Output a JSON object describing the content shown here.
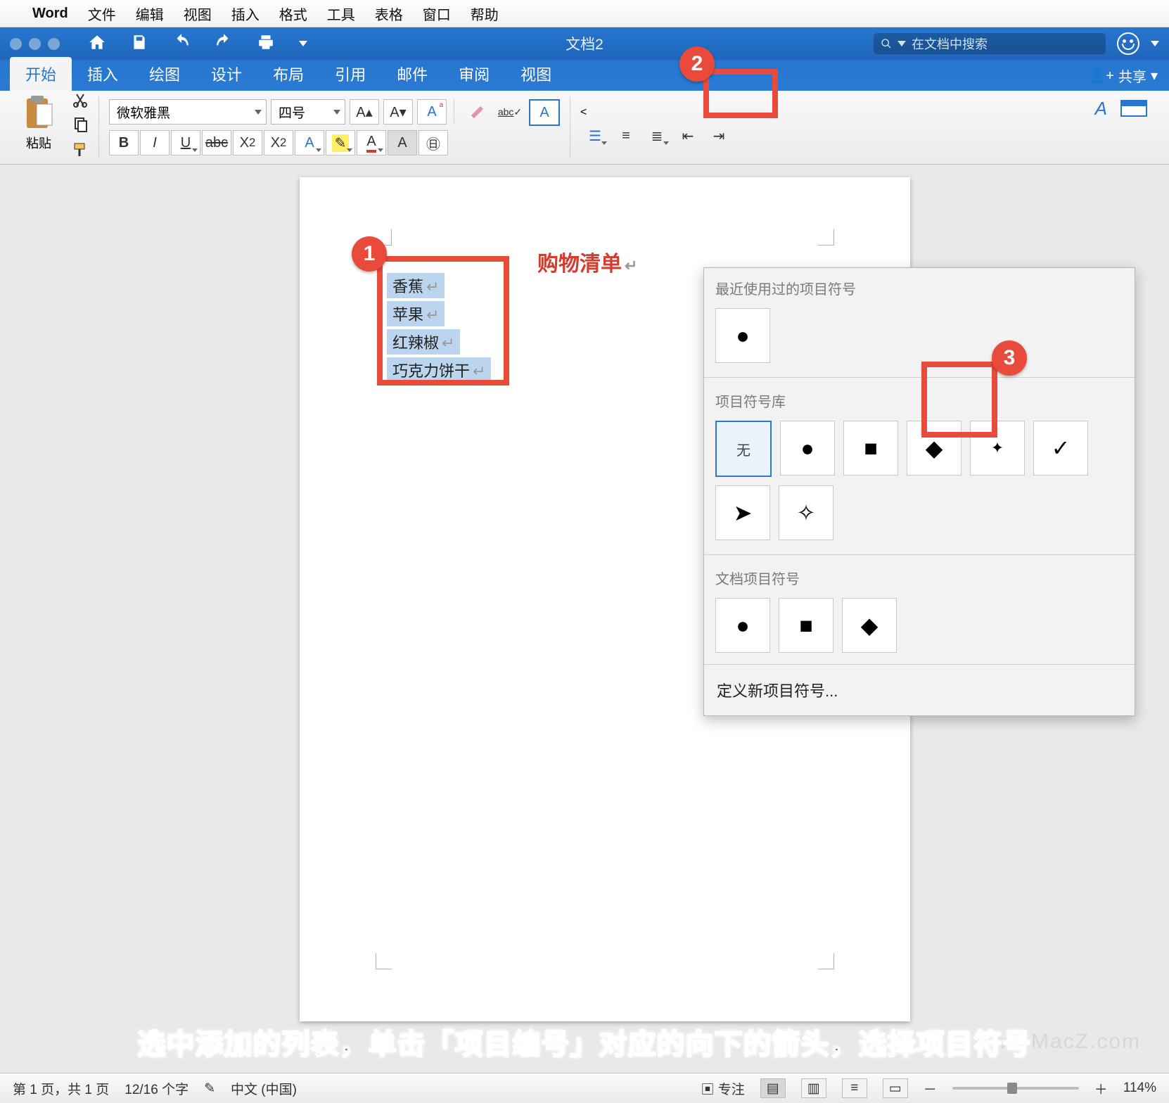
{
  "mac_menu": {
    "app": "Word",
    "items": [
      "文件",
      "编辑",
      "视图",
      "插入",
      "格式",
      "工具",
      "表格",
      "窗口",
      "帮助"
    ]
  },
  "titlebar": {
    "doc": "文档2",
    "search_placeholder": "在文档中搜索"
  },
  "ribbon_tabs": [
    "开始",
    "插入",
    "绘图",
    "设计",
    "布局",
    "引用",
    "邮件",
    "审阅",
    "视图"
  ],
  "ribbon_active_tab": "开始",
  "share_label": "共享",
  "paste_label": "粘贴",
  "font": {
    "name": "微软雅黑",
    "size": "四号"
  },
  "document": {
    "heading": "购物清单",
    "list": [
      "香蕉",
      "苹果",
      "红辣椒",
      "巧克力饼干"
    ]
  },
  "bullet_panel": {
    "recent_label": "最近使用过的项目符号",
    "recent": [
      "disc"
    ],
    "library_label": "项目符号库",
    "library": [
      "无",
      "disc",
      "square",
      "diamond",
      "image",
      "check",
      "arrow",
      "star4"
    ],
    "document_label": "文档项目符号",
    "doc_bullets": [
      "disc",
      "square",
      "diamond"
    ],
    "define_new": "定义新项目符号...",
    "selected_library_index": 0,
    "highlight_index": 3
  },
  "annotations": {
    "step1": "1",
    "step2": "2",
    "step3": "3"
  },
  "caption": "选中添加的列表，单击「项目编号」对应的向下的箭头，选择项目符号",
  "watermark": "www.MacZ.com",
  "statusbar": {
    "page": "第 1 页，共 1 页",
    "words": "12/16 个字",
    "lang": "中文 (中国)",
    "focus": "专注",
    "zoom": "114%"
  }
}
